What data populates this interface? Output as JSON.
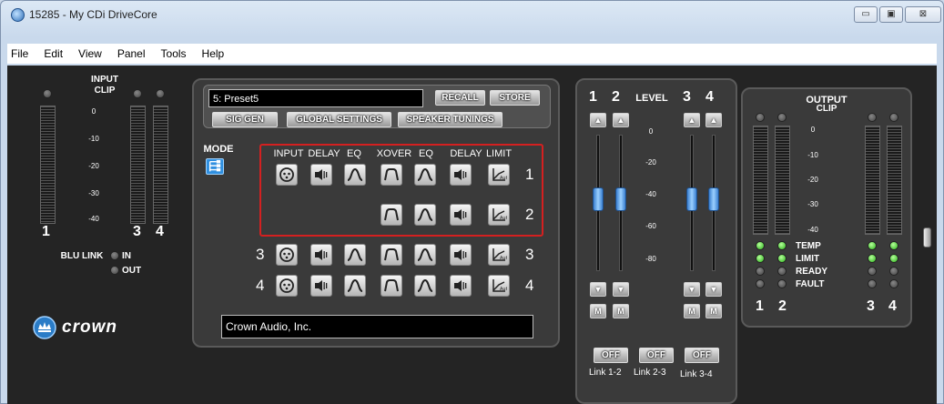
{
  "window": {
    "title": "15285 - My CDi DriveCore",
    "btn_minimize": "▭",
    "btn_maximize": "▣",
    "btn_close": "⊠"
  },
  "menu": [
    "File",
    "Edit",
    "View",
    "Panel",
    "Tools",
    "Help"
  ],
  "input": {
    "title_line1": "INPUT",
    "title_line2": "CLIP",
    "scale": [
      "0",
      "-10",
      "-20",
      "-30",
      "-40"
    ],
    "ch1": "1",
    "ch3": "3",
    "ch4": "4",
    "blu_link": "BLU LINK",
    "in": "IN",
    "out": "OUT"
  },
  "brand": {
    "logo_text": "crown"
  },
  "dsp": {
    "preset_value": "5: Preset5",
    "recall": "RECALL",
    "store": "STORE",
    "sig_gen": "SIG GEN",
    "global_settings": "GLOBAL SETTINGS",
    "speaker_tunings": "SPEAKER TUNINGS",
    "mode": "MODE",
    "headers": [
      "INPUT",
      "DELAY",
      "EQ",
      "XOVER",
      "EQ",
      "DELAY",
      "LIMIT"
    ],
    "channels": [
      "1",
      "2",
      "3",
      "4"
    ],
    "footer_text": "Crown Audio, Inc."
  },
  "level": {
    "title": "LEVEL",
    "ch_labels": [
      "1",
      "2",
      "3",
      "4"
    ],
    "scale": [
      "0",
      "-20",
      "-40",
      "-60",
      "-80"
    ],
    "up": "▲",
    "down": "▼",
    "mute": "M",
    "faders": [
      0.55,
      0.55,
      0.55,
      0.55
    ],
    "links": [
      {
        "btn": "OFF",
        "label": "Link 1-2"
      },
      {
        "btn": "OFF",
        "label": "Link 2-3"
      },
      {
        "btn": "OFF",
        "label": "Link 3-4"
      }
    ]
  },
  "output": {
    "title_line1": "OUTPUT",
    "title_line2": "CLIP",
    "scale": [
      "0",
      "-10",
      "-20",
      "-30",
      "-40"
    ],
    "status": [
      "TEMP",
      "LIMIT",
      "READY",
      "FAULT"
    ],
    "ch_labels": [
      "1",
      "2",
      "3",
      "4"
    ]
  },
  "colors": {
    "accent": "#3a7fd0",
    "highlight": "#d42020",
    "led_green": "#29b11a"
  }
}
